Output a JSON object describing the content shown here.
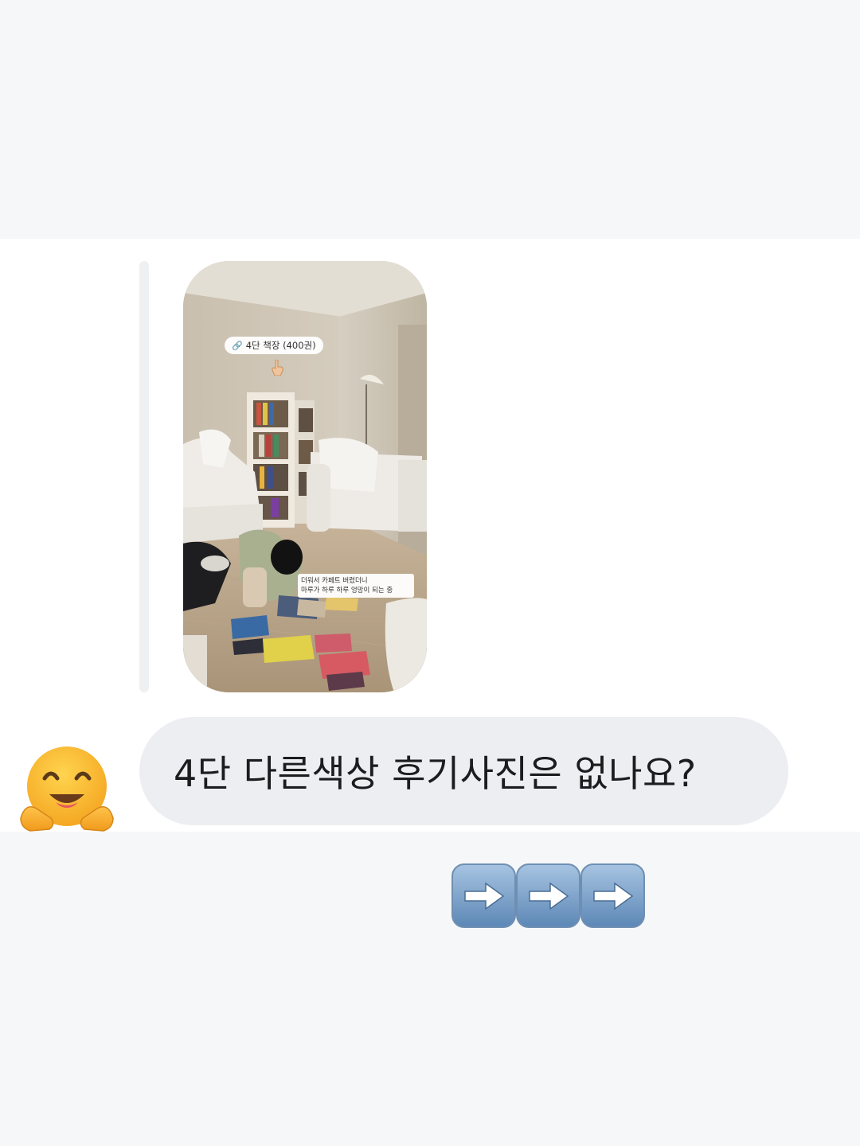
{
  "photo": {
    "tag_label": "4단 책장 (400권)",
    "link_icon": "link-icon",
    "pointer_icon": "pointing-down-hand-icon",
    "caption_line1": "더워서 카페트 버렸더니",
    "caption_line2": "마루가 하루 하루 엉망이 되는 중"
  },
  "message": {
    "text": "4단 다른색상 후기사진은 없나요?"
  },
  "avatar": {
    "emoji": "hugging-face-icon"
  },
  "footer": {
    "arrow_count": 3,
    "arrow_icon": "right-arrow-button-icon"
  },
  "colors": {
    "bubble_bg": "#eceef1",
    "page_bg": "#f6f7f8",
    "chat_bg": "#ffffff",
    "arrow_key": "#7fa6ce"
  }
}
